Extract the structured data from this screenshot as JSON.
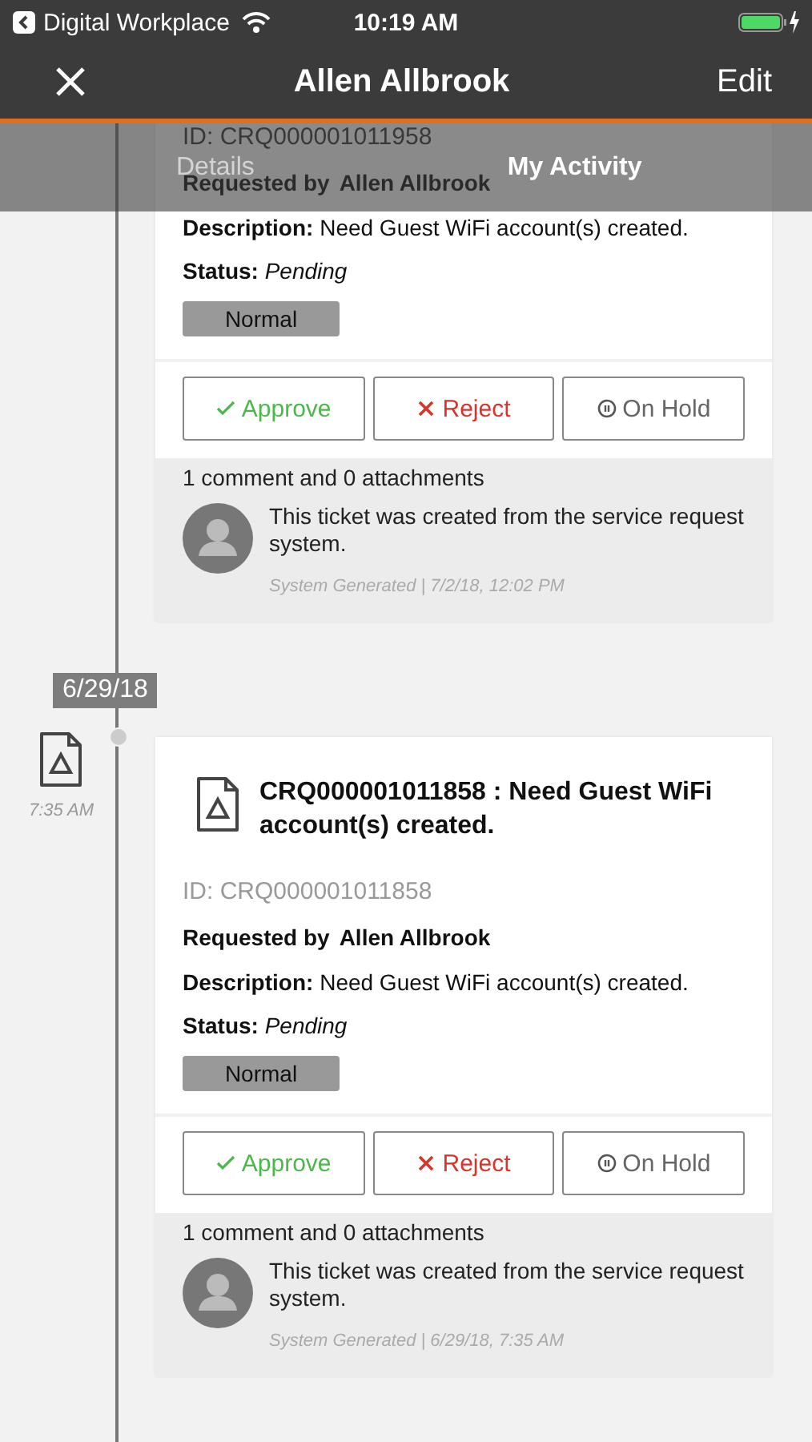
{
  "status_bar": {
    "back_app": "Digital Workplace",
    "time": "10:19 AM"
  },
  "nav": {
    "title": "Allen Allbrook",
    "action": "Edit"
  },
  "tabs": [
    {
      "label": "Details",
      "selected": false
    },
    {
      "label": "My Activity",
      "selected": true
    }
  ],
  "entries": [
    {
      "id": "ID: CRQ000001011958",
      "requested_label": "Requested by",
      "requester": "Allen Allbrook",
      "description": "**Description:** Need Guest WiFi account(s) created.",
      "status": "**Status:** *Pending*",
      "priority": "Normal",
      "actions": [
        {
          "kind": "approve",
          "label": "Approve"
        },
        {
          "kind": "reject",
          "label": "Reject"
        },
        {
          "kind": "hold",
          "label": "On Hold"
        }
      ],
      "comments_summary": "1 comment and 0 attachments",
      "comment": {
        "text": "This ticket was created from the service request system.",
        "meta": "System Generated | 7/2/18, 12:02 PM"
      }
    },
    {
      "date": "6/29/18",
      "time": "7:35 AM",
      "title": "CRQ000001011858 : Need Guest WiFi account(s) created.",
      "id": "ID: CRQ000001011858",
      "requested_label": "Requested by",
      "requester": "Allen Allbrook",
      "description": "**Description:** Need Guest WiFi account(s) created.",
      "status": "**Status:** *Pending*",
      "priority": "Normal",
      "actions": [
        {
          "kind": "approve",
          "label": "Approve"
        },
        {
          "kind": "reject",
          "label": "Reject"
        },
        {
          "kind": "hold",
          "label": "On Hold"
        }
      ],
      "comments_summary": "1 comment and 0 attachments",
      "comment": {
        "text": "This ticket was created from the service request system.",
        "meta": "System Generated | 6/29/18, 7:35 AM"
      }
    }
  ]
}
